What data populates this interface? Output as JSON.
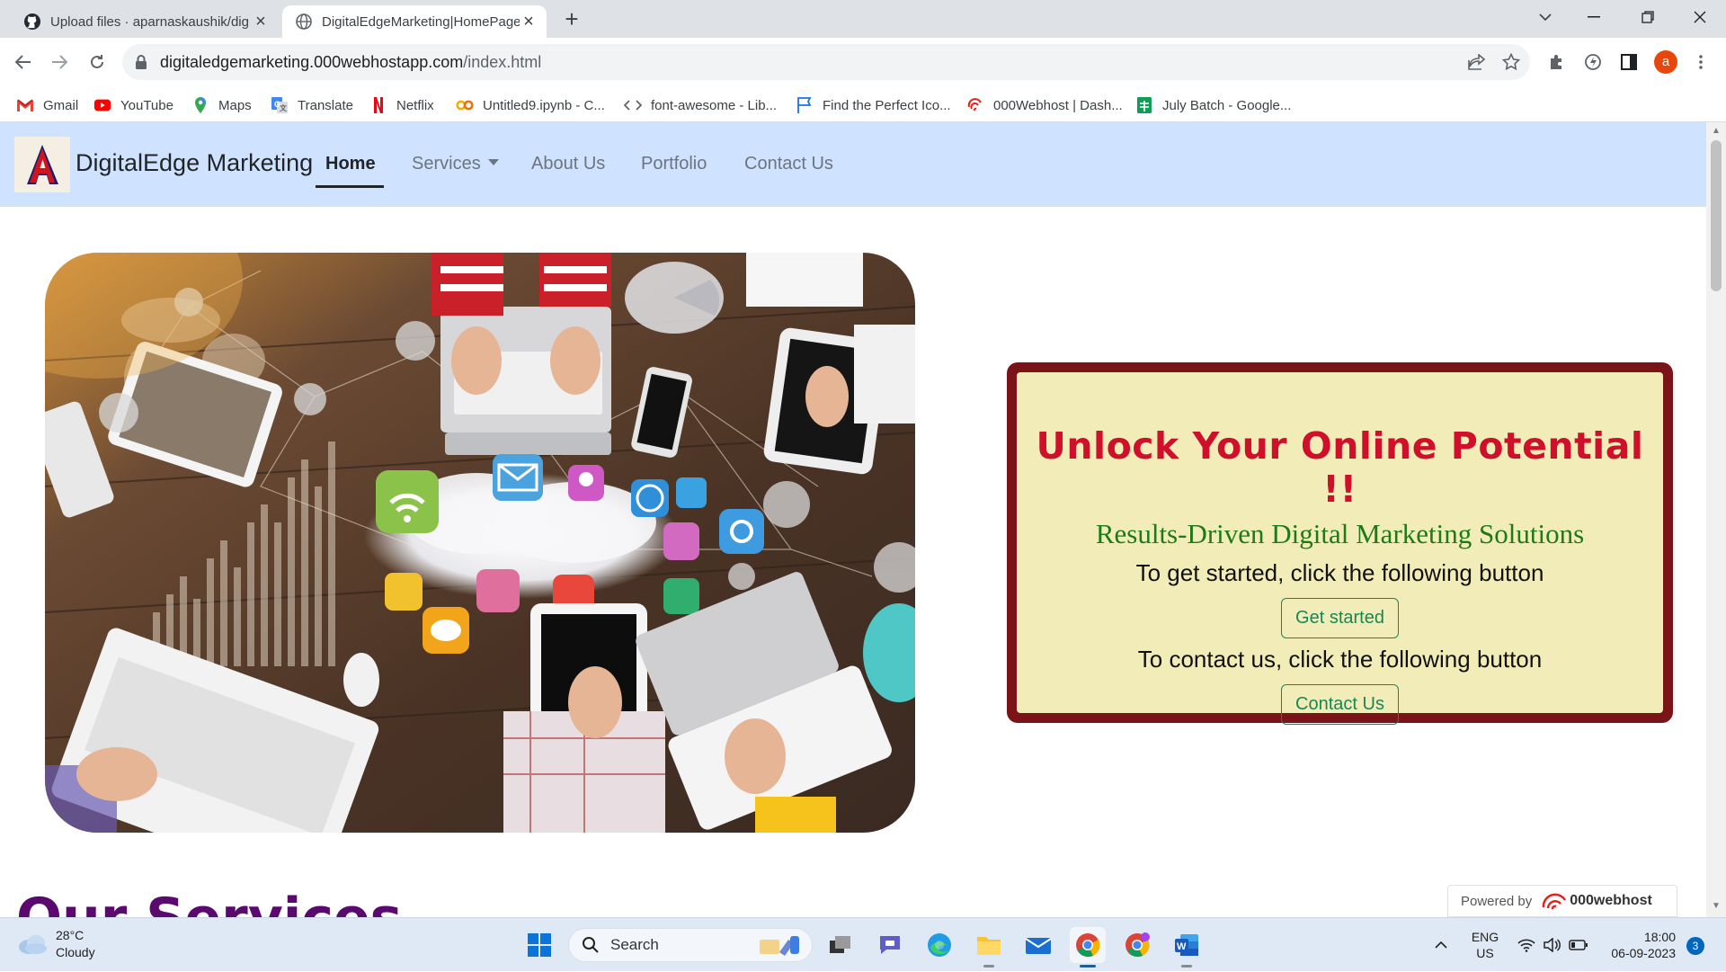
{
  "browser": {
    "tabs": [
      {
        "title": "Upload files · aparnaskaushik/dig",
        "active": false
      },
      {
        "title": "DigitalEdgeMarketing|HomePage",
        "active": true
      }
    ],
    "url_host": "digitaledgemarketing.000webhostapp.com",
    "url_path": "/index.html",
    "profile_initial": "a",
    "bookmarks": [
      {
        "label": "Gmail",
        "icon": "gmail-icon"
      },
      {
        "label": "YouTube",
        "icon": "youtube-icon"
      },
      {
        "label": "Maps",
        "icon": "maps-icon"
      },
      {
        "label": "Translate",
        "icon": "translate-icon"
      },
      {
        "label": "Netflix",
        "icon": "netflix-icon"
      },
      {
        "label": "Untitled9.ipynb - C...",
        "icon": "colab-icon"
      },
      {
        "label": "font-awesome - Lib...",
        "icon": "code-icon"
      },
      {
        "label": "Find the Perfect Ico...",
        "icon": "flag-icon"
      },
      {
        "label": "000Webhost | Dash...",
        "icon": "webhost-icon"
      },
      {
        "label": "July Batch - Google...",
        "icon": "sheets-icon"
      }
    ]
  },
  "site": {
    "brand": "DigitalEdge Marketing",
    "nav": [
      {
        "label": "Home",
        "active": true
      },
      {
        "label": "Services",
        "dropdown": true
      },
      {
        "label": "About Us"
      },
      {
        "label": "Portfolio"
      },
      {
        "label": "Contact Us"
      }
    ],
    "cta": {
      "title": "Unlock Your Online Potential !!",
      "subtitle": "Results-Driven Digital Marketing Solutions",
      "line1": "To get started, click the following button",
      "button1": "Get started",
      "line2": "To contact us, click the following button",
      "button2": "Contact Us"
    },
    "next_section_peek": "Our Services",
    "powered_by": "Powered by",
    "powered_brand": "000webhost"
  },
  "taskbar": {
    "weather_temp": "28°C",
    "weather_desc": "Cloudy",
    "search_placeholder": "Search",
    "lang_line1": "ENG",
    "lang_line2": "US",
    "time": "18:00",
    "date": "06-09-2023",
    "notification_count": "3"
  },
  "colors": {
    "navbar_bg": "#cfe2ff",
    "cta_border": "#7a1418",
    "cta_bg": "#f2edb8",
    "cta_title": "#d0102a",
    "cta_subtitle": "#1f7a16",
    "button_outline": "#198754"
  }
}
